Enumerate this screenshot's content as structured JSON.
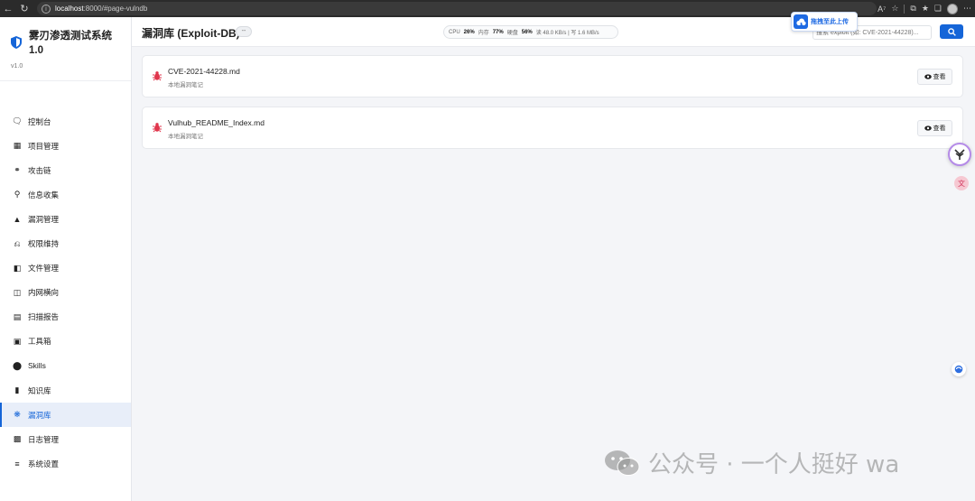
{
  "browser": {
    "url_host": "localhost",
    "url_rest": ":8000/#page-vulndb"
  },
  "sidebar": {
    "title": "雾刃渗透测试系统 1.0",
    "version": "v1.0",
    "items": [
      {
        "label": "控制台",
        "icon": "chat-icon"
      },
      {
        "label": "项目管理",
        "icon": "project-icon"
      },
      {
        "label": "攻击链",
        "icon": "chain-icon"
      },
      {
        "label": "信息收集",
        "icon": "search-icon"
      },
      {
        "label": "漏洞管理",
        "icon": "warning-icon"
      },
      {
        "label": "权限维持",
        "icon": "pin-icon"
      },
      {
        "label": "文件管理",
        "icon": "folder-icon"
      },
      {
        "label": "内网横向",
        "icon": "network-icon"
      },
      {
        "label": "扫描报告",
        "icon": "report-icon"
      },
      {
        "label": "工具箱",
        "icon": "toolbox-icon"
      },
      {
        "label": "Skills",
        "icon": "brain-icon"
      },
      {
        "label": "知识库",
        "icon": "book-icon"
      },
      {
        "label": "漏洞库",
        "icon": "bug-icon",
        "active": true
      },
      {
        "label": "日志管理",
        "icon": "clipboard-icon"
      },
      {
        "label": "系统设置",
        "icon": "sliders-icon"
      }
    ]
  },
  "header": {
    "title": "漏洞库 (Exploit-DB)",
    "badge": "--",
    "stats": {
      "cpu_label": "CPU",
      "cpu": "26%",
      "mem_label": "内存",
      "mem": "77%",
      "disk_label": "硬盘",
      "disk": "56%",
      "net": "读 48.0 KB/s | 写 1.6 MB/s"
    },
    "search_placeholder": "搜索 exploit (如: CVE-2021-44228)...",
    "upload_label": "拖拽至此上传"
  },
  "entries": [
    {
      "name": "CVE-2021-44228.md",
      "desc": "本地漏洞笔记",
      "action": "查看"
    },
    {
      "name": "Vulhub_README_Index.md",
      "desc": "本地漏洞笔记",
      "action": "查看"
    }
  ],
  "watermark": "公众号 · 一个人挺好 wa",
  "colors": {
    "accent": "#1565d8",
    "bug": "#e0364c"
  }
}
